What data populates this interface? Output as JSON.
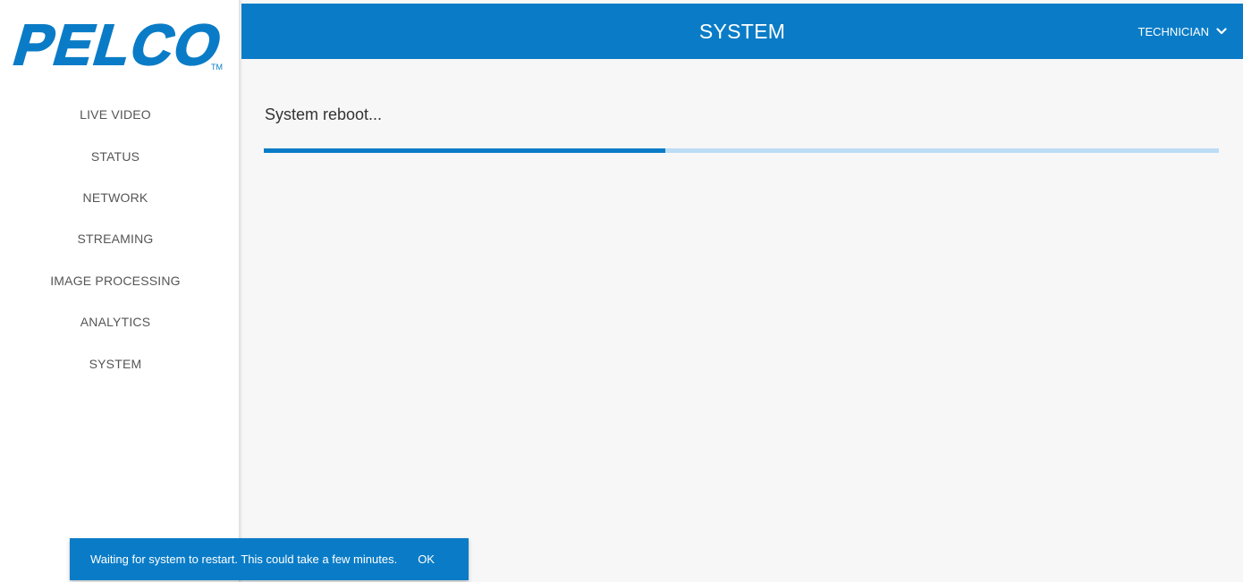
{
  "logo": {
    "text": "PELCO",
    "trademark": "TM"
  },
  "sidebar": {
    "items": [
      {
        "label": "LIVE VIDEO"
      },
      {
        "label": "STATUS"
      },
      {
        "label": "NETWORK"
      },
      {
        "label": "STREAMING"
      },
      {
        "label": "IMAGE PROCESSING"
      },
      {
        "label": "ANALYTICS"
      },
      {
        "label": "SYSTEM"
      }
    ]
  },
  "header": {
    "title": "SYSTEM",
    "user_label": "TECHNICIAN",
    "user_icon": "chevron-down-icon"
  },
  "main": {
    "title": "System reboot...",
    "progress_fraction": 0.42
  },
  "snackbar": {
    "message": "Waiting for system to restart. This could take a few minutes.",
    "action_label": "OK"
  },
  "colors": {
    "brand_blue": "#0a7cc7",
    "progress_track": "#bcdcf5",
    "background": "#f7f7f7"
  }
}
